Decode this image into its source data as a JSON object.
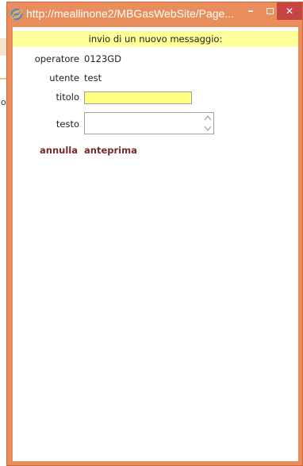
{
  "window": {
    "title": "http://meallinone2/MBGasWebSite/Page...",
    "frame_color": "#ea8d5d",
    "close_color": "#c74444"
  },
  "background_page": {
    "fragment_letter": "o"
  },
  "form": {
    "header": "invio di un nuovo messaggio:",
    "header_color": "#ffff99",
    "operatore_label": "operatore",
    "operatore_value": "0123GD",
    "utente_label": "utente",
    "utente_value": "test",
    "titolo_label": "titolo",
    "titolo_value": "",
    "testo_label": "testo",
    "testo_value": "",
    "input_highlight_color": "#ffff80"
  },
  "actions": {
    "annulla_label": "annulla",
    "anteprima_label": "anteprima",
    "link_color": "#7a2a2a"
  }
}
